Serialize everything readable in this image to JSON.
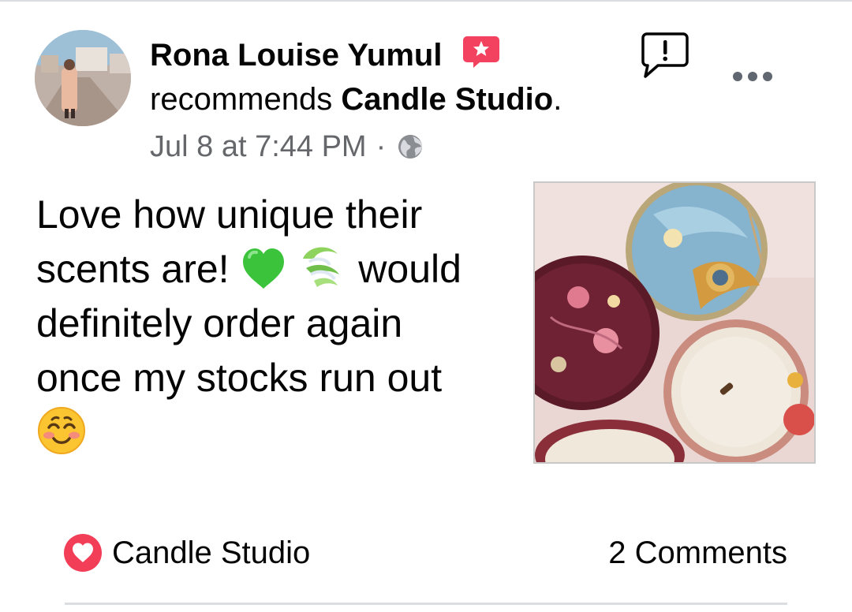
{
  "post": {
    "author": "Rona Louise Yumul",
    "recommends_word": "recommends",
    "page_name": "Candle Studio",
    "period": ".",
    "timestamp": "Jul 8 at 7:44 PM",
    "separator": "·",
    "audience_icon": "globe-icon",
    "text_line1": "Love how unique their",
    "text_line2a": "scents are!",
    "text_line2b": "would",
    "text_line3": "definitely order again",
    "text_line4": "once my stocks run out",
    "emojis": [
      "green-heart-emoji",
      "dashing-away-emoji",
      "smiling-face-emoji"
    ]
  },
  "footer": {
    "reaction_icon": "heart-icon",
    "reaction_label": "Candle Studio",
    "comments_label": "2 Comments"
  },
  "colors": {
    "text_primary": "#050505",
    "text_secondary": "#65676b",
    "recommend_badge": "#f3425f",
    "heart": "#f33e58",
    "divider": "#dadde1"
  }
}
